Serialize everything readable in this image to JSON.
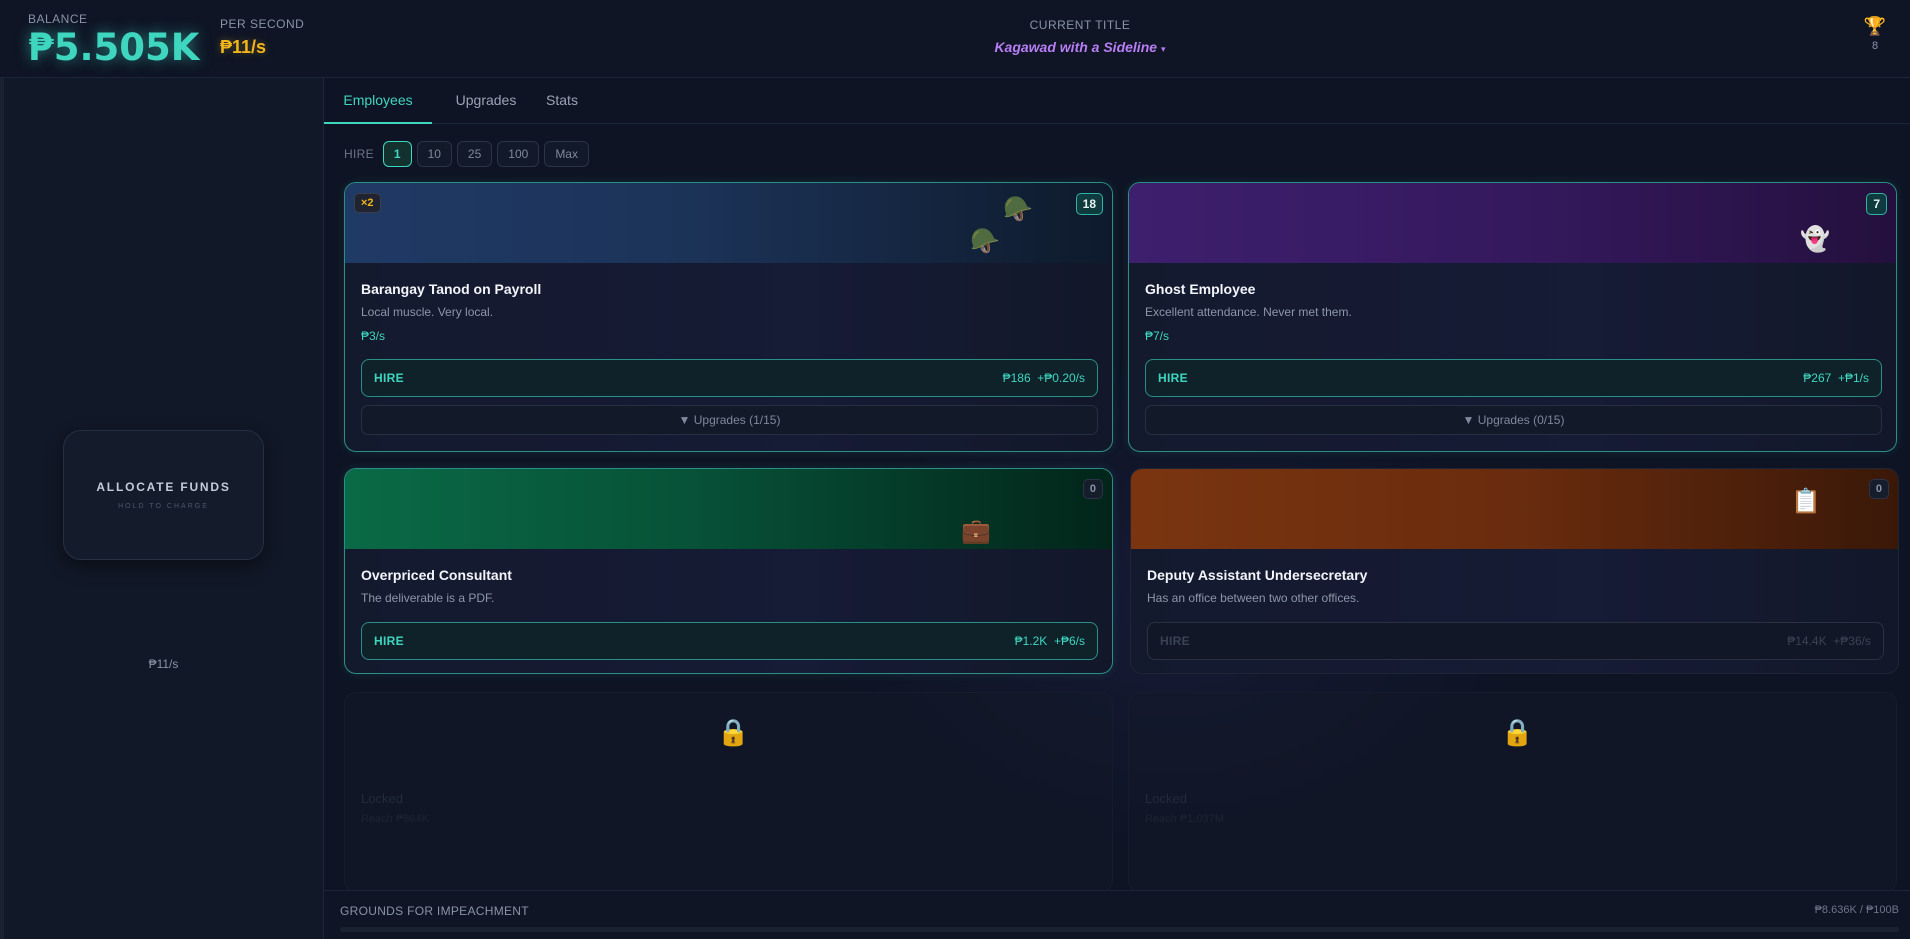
{
  "header": {
    "balance_label": "BALANCE",
    "balance_value": "₱5.505K",
    "per_second_label": "PER SECOND",
    "per_second_value": "₱11/s",
    "current_title_label": "CURRENT TITLE",
    "current_title_value": "Kagawad with a Sideline",
    "title_caret": "▾",
    "trophy_icon": "🏆",
    "trophy_count": "8"
  },
  "left": {
    "allocate_title": "ALLOCATE FUNDS",
    "allocate_sub": "HOLD TO CHARGE",
    "rate": "₱11/s"
  },
  "tabs": [
    {
      "label": "Employees",
      "active": true
    },
    {
      "label": "Upgrades",
      "active": false
    },
    {
      "label": "Stats",
      "active": false
    }
  ],
  "hire": {
    "label": "HIRE",
    "options": [
      "1",
      "10",
      "25",
      "100",
      "Max"
    ],
    "selected": "1"
  },
  "cards": [
    {
      "name": "Barangay Tanod on Payroll",
      "desc": "Local muscle. Very local.",
      "rate": "₱3/s",
      "count": "18",
      "multiplier": "×2",
      "emoji": "🪖",
      "hire_label": "HIRE",
      "hire_cost": "₱186",
      "hire_gain": "+₱0.20/s",
      "upgrades_label": "▼ Upgrades (1/15)"
    },
    {
      "name": "Ghost Employee",
      "desc": "Excellent attendance. Never met them.",
      "rate": "₱7/s",
      "count": "7",
      "emoji": "👻",
      "hire_label": "HIRE",
      "hire_cost": "₱267",
      "hire_gain": "+₱1/s",
      "upgrades_label": "▼ Upgrades (0/15)"
    },
    {
      "name": "Overpriced Consultant",
      "desc": "The deliverable is a PDF.",
      "count": "0",
      "emoji": "💼",
      "hire_label": "HIRE",
      "hire_cost": "₱1.2K",
      "hire_gain": "+₱6/s"
    },
    {
      "name": "Deputy Assistant Undersecretary",
      "desc": "Has an office between two other offices.",
      "count": "0",
      "emoji": "📋",
      "hire_label": "HIRE",
      "hire_cost": "₱14.4K",
      "hire_gain": "+₱36/s"
    }
  ],
  "locked": [
    {
      "icon": "🔒",
      "title": "Locked",
      "sub": "Reach ₱864K"
    },
    {
      "icon": "🔒",
      "title": "Locked",
      "sub": "Reach ₱1.037M"
    }
  ],
  "footer": {
    "label": "GROUNDS FOR IMPEACHMENT",
    "value": "₱8.636K / ₱100B",
    "progress_fraction": 8.64e-08
  },
  "colors": {
    "accent": "#3fd6c0",
    "gold": "#f2b61c",
    "title_purple": "#b77ef5",
    "background": "#0d1220"
  }
}
